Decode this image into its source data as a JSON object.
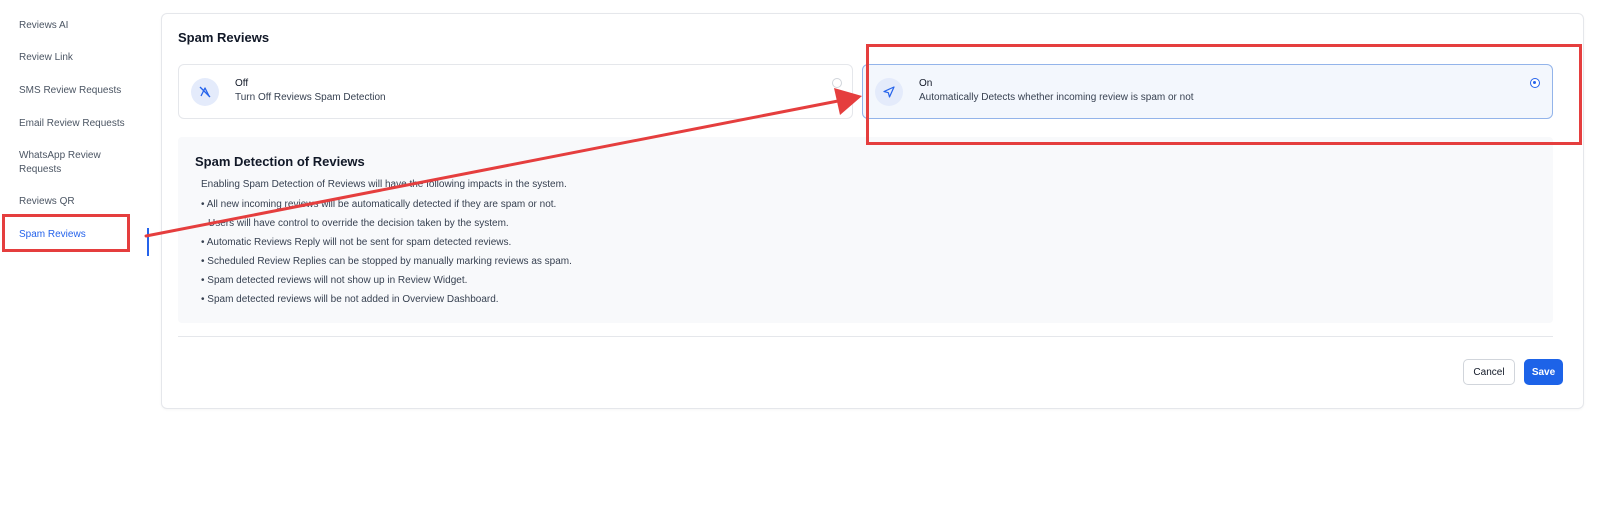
{
  "sidebar": {
    "items": [
      {
        "label": "Reviews AI"
      },
      {
        "label": "Review Link"
      },
      {
        "label": "SMS Review Requests"
      },
      {
        "label": "Email Review Requests"
      },
      {
        "label": "WhatsApp Review Requests"
      },
      {
        "label": "Reviews QR"
      },
      {
        "label": "Spam Reviews",
        "active": true
      }
    ]
  },
  "main": {
    "title": "Spam Reviews",
    "options": {
      "off": {
        "title": "Off",
        "description": "Turn Off Reviews Spam Detection",
        "icon": "disable-icon",
        "selected": false
      },
      "on": {
        "title": "On",
        "description": "Automatically Detects whether incoming review is spam or not",
        "icon": "send-icon",
        "selected": true
      }
    },
    "info": {
      "title": "Spam Detection of Reviews",
      "intro": "Enabling Spam Detection of Reviews will have the following impacts in the system.",
      "points": [
        "All new incoming reviews will be automatically detected if they are spam or not.",
        "Users will have control to override the decision taken by the system.",
        "Automatic Reviews Reply will not be sent for spam detected reviews.",
        "Scheduled Review Replies can be stopped by manually marking reviews as spam.",
        "Spam detected reviews will not show up in Review Widget.",
        "Spam detected reviews will be not added in Overview Dashboard."
      ]
    },
    "buttons": {
      "cancel": "Cancel",
      "save": "Save"
    }
  },
  "colors": {
    "accent": "#2563eb",
    "annotation": "#e53e3e",
    "save_button": "#1d63e8"
  }
}
